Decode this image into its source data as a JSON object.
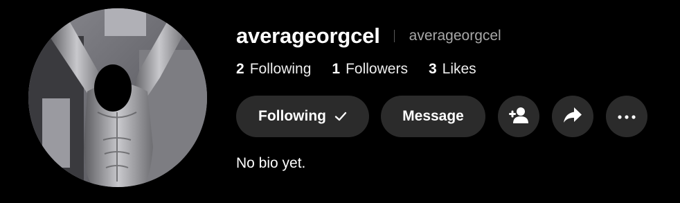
{
  "profile": {
    "display_name": "averageorgcel",
    "username": "averageorgcel",
    "avatar_icon": "profile-photo-avatar",
    "bio": "No bio yet."
  },
  "stats": [
    {
      "count": "2",
      "label": "Following"
    },
    {
      "count": "1",
      "label": "Followers"
    },
    {
      "count": "3",
      "label": "Likes"
    }
  ],
  "actions": {
    "following_label": "Following",
    "following_icon": "check-icon",
    "message_label": "Message",
    "suggest_icon": "add-user-icon",
    "share_icon": "share-arrow-icon",
    "more_icon": "more-dots-icon"
  },
  "colors": {
    "background": "#000000",
    "button_background": "#2b2b2b",
    "text_primary": "#ffffff",
    "text_secondary": "#a8a8a8"
  }
}
